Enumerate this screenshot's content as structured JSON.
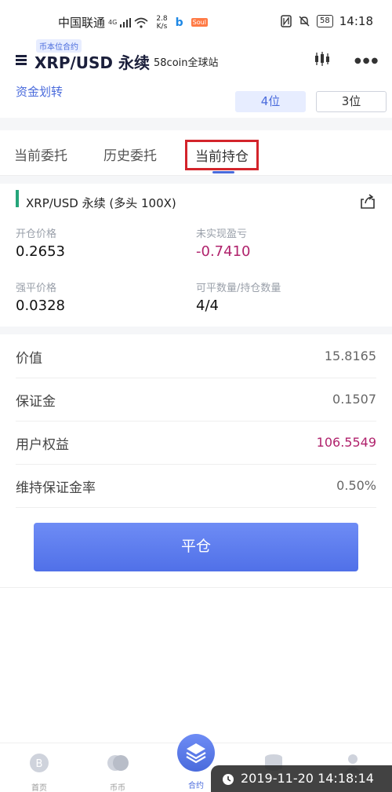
{
  "status_bar": {
    "carrier": "中国联通",
    "network_type": "4G",
    "speed": "2.8",
    "speed_unit": "K/s",
    "b_icon": "b",
    "badge": "Soul",
    "battery": "58",
    "time": "14:18"
  },
  "header": {
    "tag": "币本位合约",
    "title": "XRP/USD 永续",
    "subtitle": "58coin全球站",
    "more_label": "●●●"
  },
  "transfer": {
    "link": "资金划转",
    "digit_a": "4位",
    "digit_b": "3位"
  },
  "tabs": [
    {
      "label": "当前委托"
    },
    {
      "label": "历史委托"
    },
    {
      "label": "当前持仓"
    }
  ],
  "position": {
    "title": "XRP/USD 永续 (多头 100X)",
    "open_price_label": "开仓价格",
    "open_price": "0.2653",
    "unrealized_pnl_label": "未实现盈亏",
    "unrealized_pnl": "-0.7410",
    "liq_price_label": "强平价格",
    "liq_price": "0.0328",
    "qty_label": "可平数量/持仓数量",
    "qty": "4/4"
  },
  "info": [
    {
      "label": "价值",
      "value": "15.8165"
    },
    {
      "label": "保证金",
      "value": "0.1507"
    },
    {
      "label": "用户权益",
      "value": "106.5549"
    },
    {
      "label": "维持保证金率",
      "value": "0.50%"
    }
  ],
  "close_button": "平仓",
  "bottom_nav": {
    "home": "首页",
    "coin": "币币",
    "contract": "合约"
  },
  "timestamp": "2019-11-20 14:18:14",
  "colors": {
    "accent": "#4a6bdc",
    "negative": "#b0226c",
    "long_indicator": "#25a57a",
    "highlight_box": "#d3242b"
  }
}
